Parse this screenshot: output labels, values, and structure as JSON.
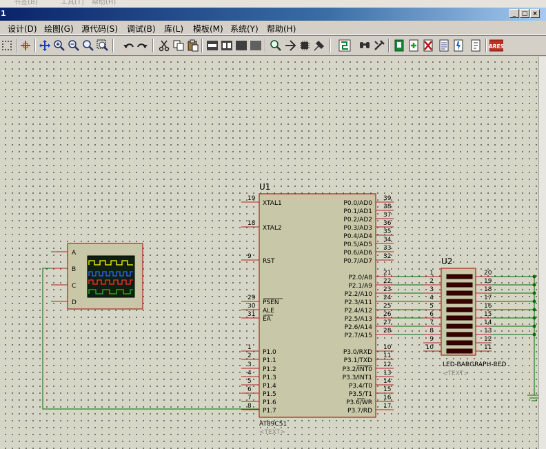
{
  "top_strip": {
    "items": [
      "书签(B)",
      "工具(T)",
      "帮助(H)"
    ]
  },
  "window": {
    "title_number": "1",
    "minimize": "_",
    "restore": "□",
    "close": "×"
  },
  "menu": [
    {
      "label": "设计(D)"
    },
    {
      "label": "绘图(G)"
    },
    {
      "label": "源代码(S)"
    },
    {
      "label": "调试(B)"
    },
    {
      "label": "库(L)"
    },
    {
      "label": "模板(M)"
    },
    {
      "label": "系统(Y)"
    },
    {
      "label": "帮助(H)"
    }
  ],
  "toolbar": {
    "icons": [
      "grid-icon",
      "origin-icon",
      "pan-icon",
      "zoom-in-icon",
      "zoom-out-icon",
      "zoom-all-icon",
      "zoom-area-icon",
      "undo-icon",
      "redo-icon",
      "cut-icon",
      "copy-icon",
      "paste-icon",
      "block-copy-icon",
      "block-move-icon",
      "block-rotate-icon",
      "block-delete-icon",
      "pick-device-icon",
      "make-device-icon",
      "package-icon",
      "decompose-icon",
      "wire-autoroute-icon",
      "search-icon",
      "property-tool-icon",
      "netlist-icon",
      "new-sheet-icon",
      "remove-sheet-icon",
      "bom-icon",
      "electrical-check-icon",
      "ares-icon"
    ],
    "ares_label": "ARES"
  },
  "schematic": {
    "u1": {
      "ref": "U1",
      "part": "AT89C51",
      "text_placeholder": "<TEXT>",
      "left_pins": [
        {
          "num": "19",
          "name": "XTAL1"
        },
        {
          "num": "18",
          "name": "XTAL2"
        },
        {
          "num": "9",
          "name": "RST"
        },
        {
          "num": "29",
          "name": "PSEN"
        },
        {
          "num": "30",
          "name": "ALE"
        },
        {
          "num": "31",
          "name": "EA"
        },
        {
          "num": "1",
          "name": "P1.0"
        },
        {
          "num": "2",
          "name": "P1.1"
        },
        {
          "num": "3",
          "name": "P1.2"
        },
        {
          "num": "4",
          "name": "P1.3"
        },
        {
          "num": "5",
          "name": "P1.4"
        },
        {
          "num": "6",
          "name": "P1.5"
        },
        {
          "num": "7",
          "name": "P1.6"
        },
        {
          "num": "8",
          "name": "P1.7"
        }
      ],
      "right_pins": [
        {
          "num": "39",
          "name": "P0.0/AD0"
        },
        {
          "num": "38",
          "name": "P0.1/AD1"
        },
        {
          "num": "37",
          "name": "P0.2/AD2"
        },
        {
          "num": "36",
          "name": "P0.3/AD3"
        },
        {
          "num": "35",
          "name": "P0.4/AD4"
        },
        {
          "num": "34",
          "name": "P0.5/AD5"
        },
        {
          "num": "33",
          "name": "P0.6/AD6"
        },
        {
          "num": "32",
          "name": "P0.7/AD7"
        },
        {
          "num": "21",
          "name": "P2.0/A8"
        },
        {
          "num": "22",
          "name": "P2.1/A9"
        },
        {
          "num": "23",
          "name": "P2.2/A10"
        },
        {
          "num": "24",
          "name": "P2.3/A11"
        },
        {
          "num": "25",
          "name": "P2.4/A12"
        },
        {
          "num": "26",
          "name": "P2.5/A13"
        },
        {
          "num": "27",
          "name": "P2.6/A14"
        },
        {
          "num": "28",
          "name": "P2.7/A15"
        },
        {
          "num": "10",
          "name": "P3.0/RXD"
        },
        {
          "num": "11",
          "name": "P3.1/TXD"
        },
        {
          "num": "12",
          "name": "P3.2/INT0"
        },
        {
          "num": "13",
          "name": "P3.3/INT1"
        },
        {
          "num": "14",
          "name": "P3.4/T0"
        },
        {
          "num": "15",
          "name": "P3.5/T1"
        },
        {
          "num": "16",
          "name": "P3.6/WR"
        },
        {
          "num": "17",
          "name": "P3.7/RD"
        }
      ]
    },
    "u2": {
      "ref": "U2",
      "part": "LED-BARGRAPH-RED",
      "text_placeholder": "<TEXT>",
      "left_pins": [
        "1",
        "2",
        "3",
        "4",
        "5",
        "6",
        "7",
        "8",
        "9",
        "10"
      ],
      "right_pins": [
        "20",
        "19",
        "18",
        "17",
        "16",
        "15",
        "14",
        "13",
        "12",
        "11"
      ]
    },
    "scope": {
      "channels": [
        "A",
        "B",
        "C",
        "D"
      ],
      "trace_colors": [
        "#ffff00",
        "#2a6bff",
        "#ff3030",
        "#20c020"
      ]
    },
    "colors": {
      "part_body": "#c8c8a8",
      "part_outline": "#b02020",
      "wire": "#007000",
      "pin_text": "#000000",
      "ref_text": "#000000",
      "placeholder_text": "#8a8a8a"
    }
  }
}
